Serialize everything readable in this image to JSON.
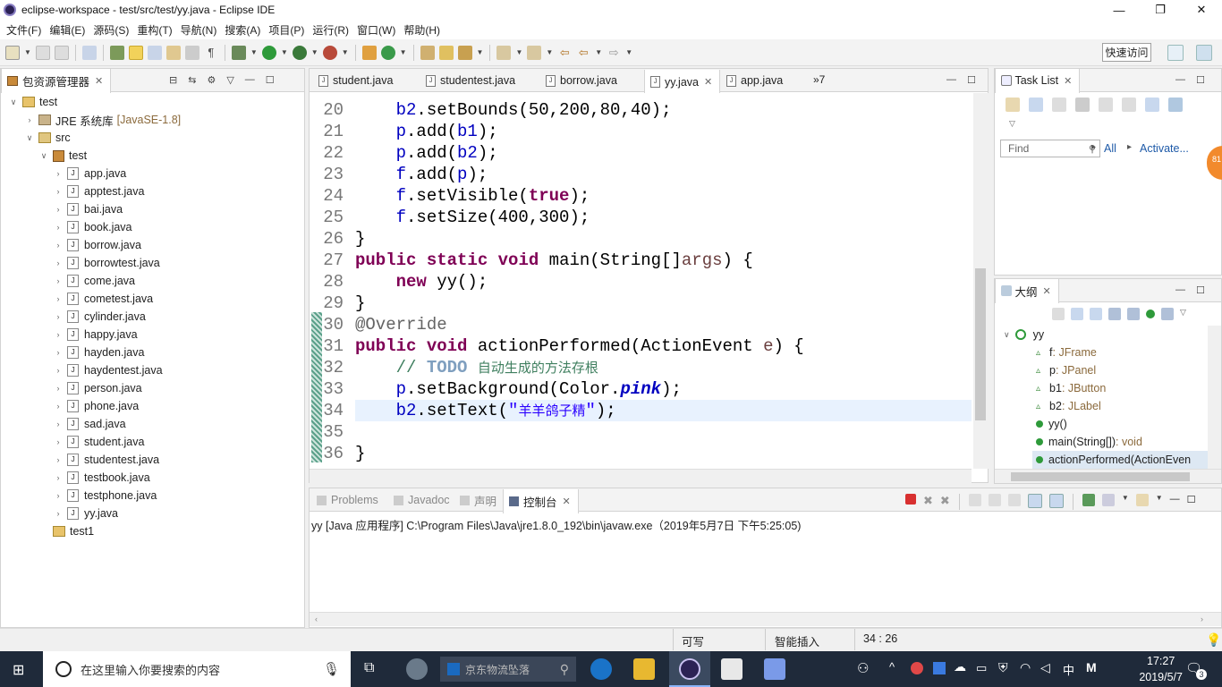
{
  "window": {
    "title": "eclipse-workspace - test/src/test/yy.java - Eclipse IDE"
  },
  "menu": [
    "文件(F)",
    "编辑(E)",
    "源码(S)",
    "重构(T)",
    "导航(N)",
    "搜索(A)",
    "项目(P)",
    "运行(R)",
    "窗口(W)",
    "帮助(H)"
  ],
  "toolbar": {
    "quick_access": "快速访问"
  },
  "package_explorer": {
    "title": "包资源管理器",
    "project": "test",
    "jre": "JRE 系统库",
    "jre_tag": "[JavaSE-1.8]",
    "src": "src",
    "package": "test",
    "files": [
      "app.java",
      "apptest.java",
      "bai.java",
      "book.java",
      "borrow.java",
      "borrowtest.java",
      "come.java",
      "cometest.java",
      "cylinder.java",
      "happy.java",
      "hayden.java",
      "haydentest.java",
      "person.java",
      "phone.java",
      "sad.java",
      "student.java",
      "studentest.java",
      "testbook.java",
      "testphone.java",
      "yy.java"
    ],
    "project2": "test1"
  },
  "editor": {
    "tabs": [
      {
        "label": "student.java",
        "active": false
      },
      {
        "label": "studentest.java",
        "active": false
      },
      {
        "label": "borrow.java",
        "active": false
      },
      {
        "label": "yy.java",
        "active": true
      },
      {
        "label": "app.java",
        "active": false
      }
    ],
    "overflow": "»7",
    "line_numbers": [
      "20",
      "21",
      "22",
      "23",
      "24",
      "25",
      "26",
      "27",
      "28",
      "29",
      "30",
      "31",
      "32",
      "33",
      "34",
      "35",
      "36"
    ]
  },
  "task_list": {
    "title": "Task List",
    "find_placeholder": "Find",
    "all": "All",
    "activate": "Activate..."
  },
  "outline": {
    "title": "大纲",
    "class": "yy",
    "members": [
      {
        "name": "f",
        "type": " : JFrame"
      },
      {
        "name": "p",
        "type": " : JPanel"
      },
      {
        "name": "b1",
        "type": " : JButton"
      },
      {
        "name": "b2",
        "type": " : JLabel"
      },
      {
        "name": "yy()",
        "type": ""
      },
      {
        "name": "main(String[])",
        "type": " : void"
      },
      {
        "name": "actionPerformed(ActionEven",
        "type": ""
      }
    ]
  },
  "console": {
    "tabs": [
      "Problems",
      "Javadoc",
      "声明",
      "控制台"
    ],
    "header": "yy [Java 应用程序] C:\\Program Files\\Java\\jre1.8.0_192\\bin\\javaw.exe（2019年5月7日 下午5:25:05)"
  },
  "status": {
    "writable": "可写",
    "insert_mode": "智能插入",
    "position": "34 : 26"
  },
  "taskbar": {
    "search_placeholder": "在这里输入你要搜索的内容",
    "news": "京东物流坠落",
    "time": "17:27",
    "date": "2019/5/7",
    "lang": "中",
    "notif_count": "3"
  },
  "colors": {
    "keyword": "#7f0055",
    "field": "#0000c0",
    "string": "#2a00ff",
    "comment": "#3f7f5f",
    "taskbar": "#1f2a3a"
  }
}
